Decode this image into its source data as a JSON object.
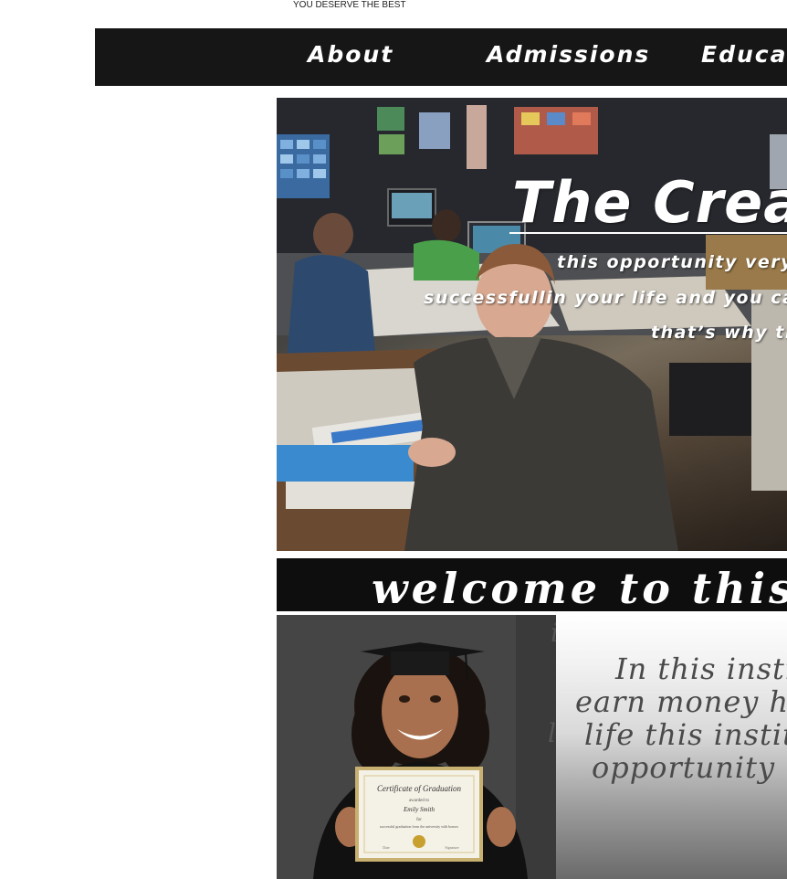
{
  "header": {
    "tagline": "YOU DESERVE THE BEST"
  },
  "nav": {
    "items": [
      {
        "label": "About"
      },
      {
        "label": "Admissions"
      },
      {
        "label": "Educat"
      }
    ]
  },
  "hero": {
    "title": "The Creat",
    "lines": [
      "this opportunity very",
      "successfullin your life  and you ca",
      "that’s why th"
    ]
  },
  "welcome": {
    "text": "welcome to this in"
  },
  "info": {
    "lines": [
      "In this instit",
      "earn money ho",
      "life this institu",
      "opportunity ."
    ]
  },
  "certificate": {
    "title": "Certificate of Graduation",
    "awarded": "awarded to",
    "name": "Emily Smith",
    "for_word": "for",
    "reason": "successful graduation from the university with honors",
    "date_label": "Date",
    "signature_label": "Signature"
  },
  "colors": {
    "navbar": "#161616",
    "welcome_bar": "#0e0e0e",
    "text_light": "#ffffff"
  }
}
